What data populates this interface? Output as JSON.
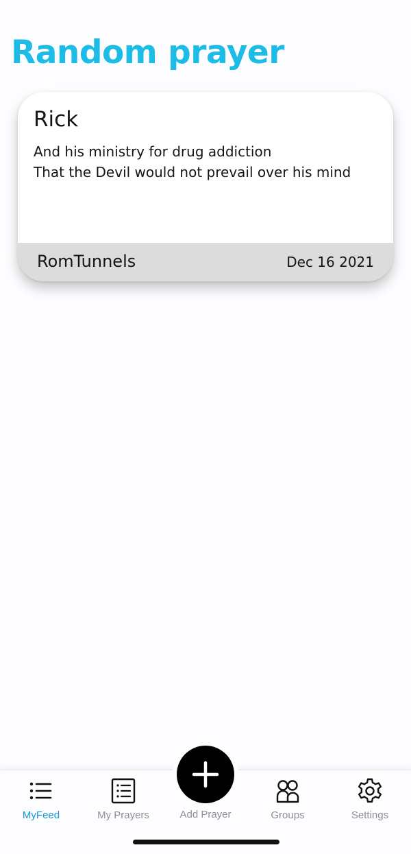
{
  "page": {
    "title": "Random prayer",
    "title_color": "#1cbce6"
  },
  "prayer_card": {
    "name": "Rick",
    "lines": [
      "And his ministry for drug addiction",
      "That the Devil would not prevail over his mind"
    ],
    "author": "RomTunnels",
    "date": "Dec 16 2021"
  },
  "tab_bar": {
    "active_color": "#1596d4",
    "inactive_color": "#8e8e93",
    "tabs": [
      {
        "label": "MyFeed",
        "icon": "list-icon",
        "active": true
      },
      {
        "label": "My Prayers",
        "icon": "notebook-list-icon",
        "active": false
      },
      {
        "label": "Add Prayer",
        "icon": "plus-icon",
        "active": false
      },
      {
        "label": "Groups",
        "icon": "people-icon",
        "active": false
      },
      {
        "label": "Settings",
        "icon": "gear-icon",
        "active": false
      }
    ]
  }
}
